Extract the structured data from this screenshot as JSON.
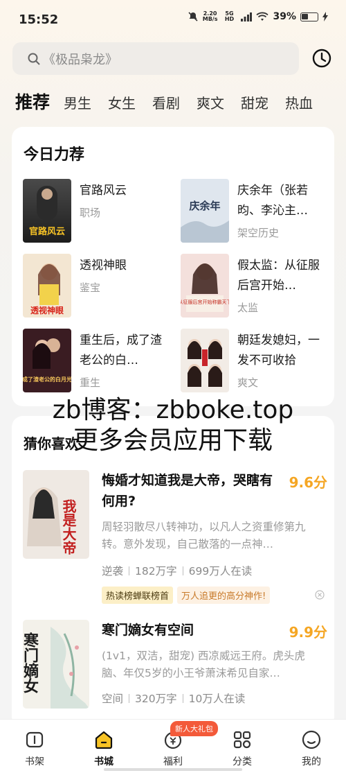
{
  "status": {
    "time": "15:52",
    "speed_top": "2.20",
    "speed_unit": "MB/s",
    "net": "5G HD",
    "battery": "39%"
  },
  "search": {
    "placeholder": "《极品枭龙》"
  },
  "tabs": [
    "推荐",
    "男生",
    "女生",
    "看剧",
    "爽文",
    "甜宠",
    "热血"
  ],
  "today": {
    "title": "今日力荐",
    "items": [
      {
        "title": "官路风云",
        "tag": "职场",
        "cover_text": "官路风云"
      },
      {
        "title": "庆余年（张若昀、李沁主…",
        "tag": "架空历史",
        "cover_text": "庆余年"
      },
      {
        "title": "透视神眼",
        "tag": "鉴宝",
        "cover_text": "透视神眼"
      },
      {
        "title": "假太监：从征服后宫开始…",
        "tag": "太监",
        "cover_text": "从征服后宫开始称霸天下"
      },
      {
        "title": "重生后，成了渣老公的白…",
        "tag": "重生",
        "cover_text": "成了渣老公的白月光"
      },
      {
        "title": "朝廷发媳妇，一发不可收拾",
        "tag": "爽文",
        "cover_text": ""
      }
    ]
  },
  "guess": {
    "title": "猜你喜欢",
    "books": [
      {
        "title": "悔婚才知道我是大帝，哭瞎有何用?",
        "score": "9.6分",
        "desc": "周轻羽散尽八转神功，以凡人之资重修第九转。意外发现，自己散落的一点神…",
        "genre": "逆袭",
        "words": "182万字",
        "readers": "699万人在读",
        "badge1": "热读榜蝉联榜首",
        "badge2": "万人追更的高分神作!",
        "cover_text": "我是大帝"
      },
      {
        "title": "寒门嫡女有空间",
        "score": "9.9分",
        "desc": "(1v1，双洁，甜宠) 西凉威远王府。虎头虎脑、年仅5岁的小王爷萧沫希见自家…",
        "genre": "空间",
        "words": "320万字",
        "readers": "10万人在读",
        "cover_text": "寒门嫡女"
      }
    ]
  },
  "watermark": {
    "line1": "zb博客：zbboke.top",
    "line2": "更多会员应用下载"
  },
  "bottom_nav": {
    "gift": "新人大礼包",
    "items": [
      "书架",
      "书城",
      "福利",
      "分类",
      "我的"
    ]
  }
}
